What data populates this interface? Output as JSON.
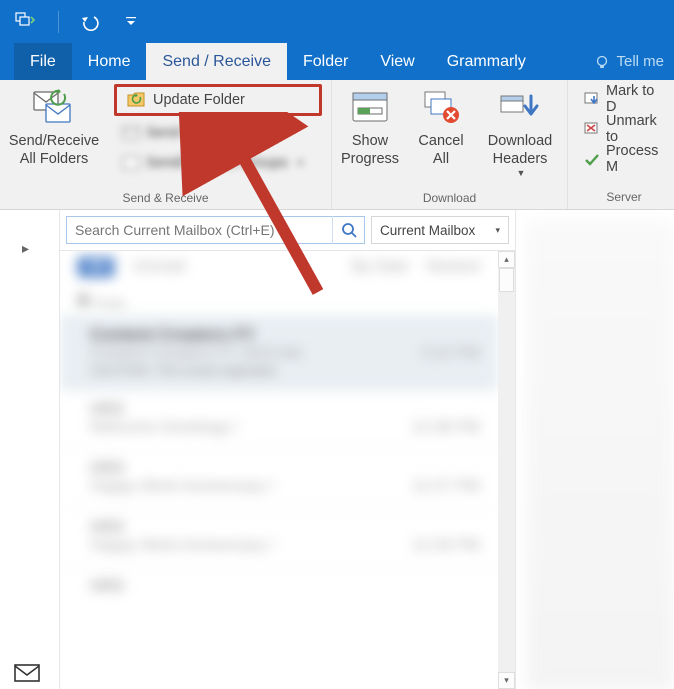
{
  "tabs": {
    "file": "File",
    "home": "Home",
    "send_receive": "Send / Receive",
    "folder": "Folder",
    "view": "View",
    "grammarly": "Grammarly",
    "tell_me": "Tell me"
  },
  "ribbon": {
    "send_receive_group": {
      "label": "Send & Receive",
      "send_receive_all": "Send/Receive\nAll Folders",
      "update_folder": "Update Folder",
      "send_all": "Send All",
      "send_receive_groups": "Send/Receive Groups"
    },
    "download_group": {
      "label": "Download",
      "show_progress": "Show\nProgress",
      "cancel_all": "Cancel\nAll",
      "download_headers": "Download\nHeaders"
    },
    "server_group": {
      "label": "Server",
      "mark_to_download": "Mark to D",
      "unmark_to_download": "Unmark to",
      "process_marked": "Process M"
    }
  },
  "search": {
    "placeholder": "Search Current Mailbox (Ctrl+E)",
    "scope": "Current Mailbox"
  },
  "filters": {
    "all": "All",
    "unread": "Unread",
    "by_date": "By Date",
    "newest": "Newest"
  },
  "group_header": "Today",
  "messages": [
    {
      "from": "Content Creators FY",
      "subject": "Content Creators FY 2023 Me",
      "preview": "CAUTION: This email originated",
      "time": "3:22 PM"
    },
    {
      "from": "HRD",
      "subject": "Welcome Greetings !",
      "preview": "",
      "time": "12:38 PM"
    },
    {
      "from": "HRD",
      "subject": "Happy Work Anniversary !",
      "preview": "",
      "time": "12:27 PM"
    },
    {
      "from": "HRD",
      "subject": "Happy Work Anniversary !",
      "preview": "",
      "time": "12:26 PM"
    },
    {
      "from": "HRD",
      "subject": "",
      "preview": "",
      "time": ""
    }
  ]
}
